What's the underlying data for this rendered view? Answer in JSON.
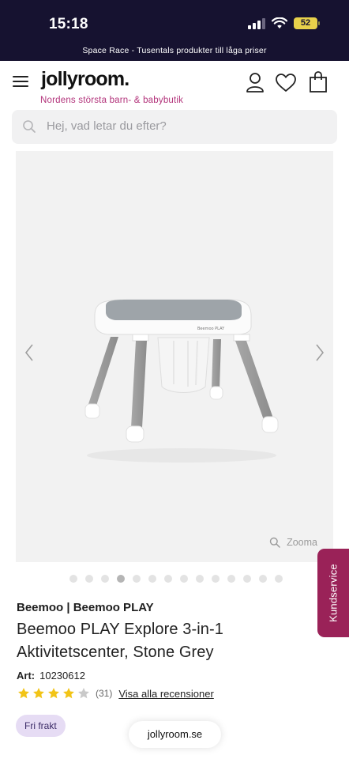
{
  "status_bar": {
    "time": "15:18",
    "battery": "52"
  },
  "promo": {
    "text": "Space Race - Tusentals produkter till låga priser"
  },
  "header": {
    "logo": "jollyroom.",
    "tagline": "Nordens största barn- & babybutik",
    "icons": [
      "menu-icon",
      "user-icon",
      "heart-icon",
      "bag-icon"
    ]
  },
  "search": {
    "placeholder": "Hej, vad letar du efter?"
  },
  "gallery": {
    "zoom_label": "Zooma",
    "image_count": 14,
    "active_index": 3
  },
  "product": {
    "brand": "Beemoo | Beemoo PLAY",
    "title": "Beemoo PLAY Explore 3-in-1 Aktivitetscenter, Stone Grey",
    "art_label": "Art:",
    "art_number": "10230612",
    "rating_value": 4,
    "rating_count": "(31)",
    "reviews_link": "Visa alla recensioner",
    "badge": "Fri frakt",
    "product_image_brand": "Beemoo PLAY"
  },
  "side_tab": {
    "label": "Kundservice"
  },
  "browser": {
    "url": "jollyroom.se"
  },
  "colors": {
    "status_bg": "#161230",
    "tagline": "#b2327a",
    "kundservice_bg": "#9a2258",
    "badge_bg": "#e6dcf4",
    "star": "#f2c417",
    "star_empty": "#c9c9c9",
    "battery": "#e8d14b"
  }
}
